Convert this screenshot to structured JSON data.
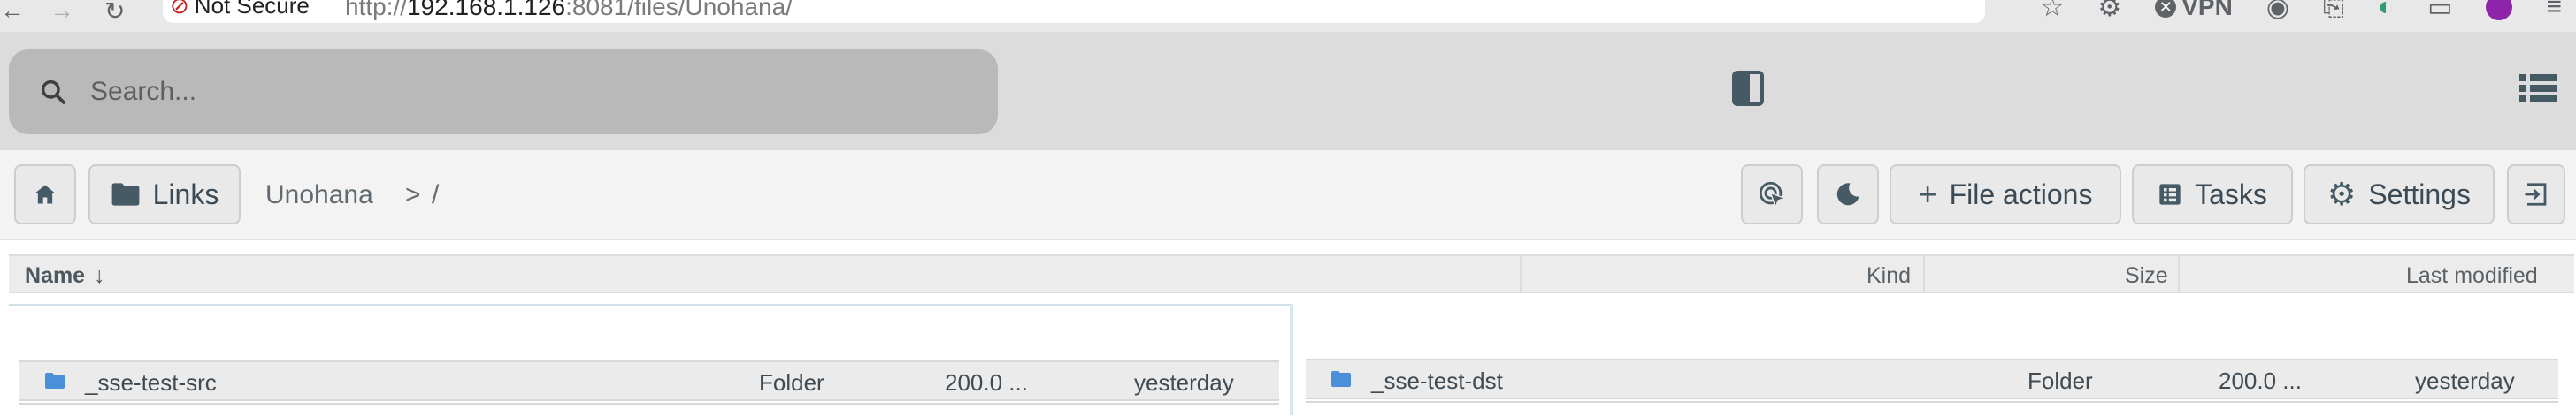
{
  "browser": {
    "security_label": "Not Secure",
    "url_scheme": "http://",
    "url_host": "192.168.1.126",
    "url_rest": ":8081/files/Unohana/",
    "vpn_label": "VPN"
  },
  "header": {
    "search_placeholder": "Search..."
  },
  "toolbar": {
    "links_label": "Links",
    "breadcrumb_item": "Unohana",
    "breadcrumb_sep": ">",
    "breadcrumb_root": "/",
    "file_actions_label": "File actions",
    "tasks_label": "Tasks",
    "settings_label": "Settings"
  },
  "columns": {
    "name": "Name",
    "sort_arrow": "↓",
    "kind": "Kind",
    "size": "Size",
    "modified": "Last modified"
  },
  "left_pane": {
    "rows": [
      {
        "name": "_sse-test-src",
        "kind": "Folder",
        "size": "200.0 ...",
        "modified": "yesterday"
      }
    ]
  },
  "right_pane": {
    "rows": [
      {
        "name": "_sse-test-dst",
        "kind": "Folder",
        "size": "200.0 ...",
        "modified": "yesterday"
      }
    ]
  },
  "colors": {
    "folder_icon": "#4a90d9",
    "icon_gray": "#455a64",
    "search_bg": "#b9b9b9",
    "header_bg": "#dcdcdc"
  }
}
